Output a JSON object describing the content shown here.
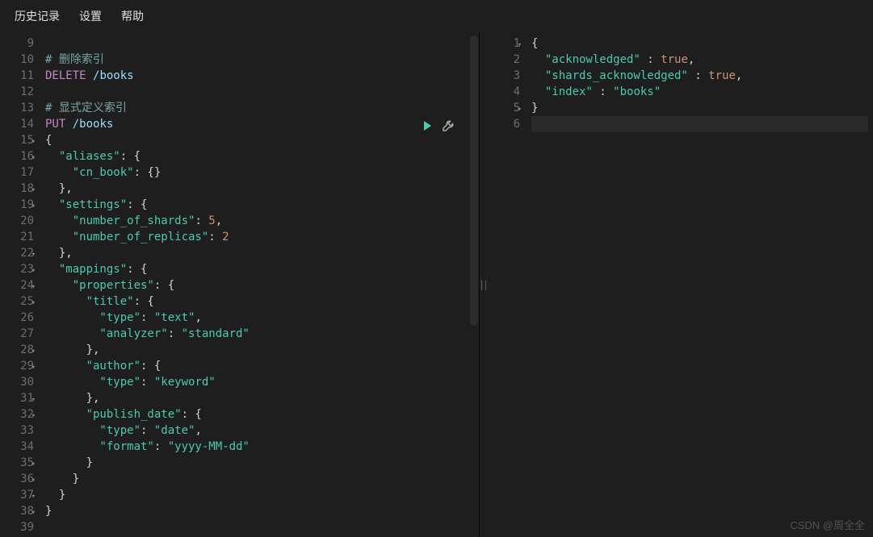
{
  "menu": {
    "history": "历史记录",
    "settings": "设置",
    "help": "帮助"
  },
  "left": {
    "lineStart": 9,
    "foldLines": [
      15,
      16,
      18,
      19,
      22,
      23,
      24,
      25,
      28,
      29,
      31,
      32,
      35,
      36,
      37,
      38
    ],
    "lines": [
      [],
      [
        {
          "t": "# ",
          "c": "comment"
        },
        {
          "t": "删除索引",
          "c": "comment"
        }
      ],
      [
        {
          "t": "DELETE",
          "c": "method"
        },
        {
          "t": " ",
          "c": "punc"
        },
        {
          "t": "/books",
          "c": "path"
        }
      ],
      [],
      [
        {
          "t": "# ",
          "c": "comment"
        },
        {
          "t": "显式定义索引",
          "c": "comment"
        }
      ],
      [
        {
          "t": "PUT",
          "c": "method"
        },
        {
          "t": " ",
          "c": "punc"
        },
        {
          "t": "/books",
          "c": "path"
        }
      ],
      [
        {
          "t": "{",
          "c": "punc"
        }
      ],
      [
        {
          "t": "  \"aliases\"",
          "c": "key"
        },
        {
          "t": ": {",
          "c": "punc"
        }
      ],
      [
        {
          "t": "    \"cn_book\"",
          "c": "key"
        },
        {
          "t": ": {}",
          "c": "punc"
        }
      ],
      [
        {
          "t": "  },",
          "c": "punc"
        }
      ],
      [
        {
          "t": "  \"settings\"",
          "c": "key"
        },
        {
          "t": ": {",
          "c": "punc"
        }
      ],
      [
        {
          "t": "    \"number_of_shards\"",
          "c": "key"
        },
        {
          "t": ": ",
          "c": "punc"
        },
        {
          "t": "5",
          "c": "num"
        },
        {
          "t": ",",
          "c": "punc"
        }
      ],
      [
        {
          "t": "    \"number_of_replicas\"",
          "c": "key"
        },
        {
          "t": ": ",
          "c": "punc"
        },
        {
          "t": "2",
          "c": "num"
        }
      ],
      [
        {
          "t": "  },",
          "c": "punc"
        }
      ],
      [
        {
          "t": "  \"mappings\"",
          "c": "key"
        },
        {
          "t": ": {",
          "c": "punc"
        }
      ],
      [
        {
          "t": "    \"properties\"",
          "c": "key"
        },
        {
          "t": ": {",
          "c": "punc"
        }
      ],
      [
        {
          "t": "      \"title\"",
          "c": "key"
        },
        {
          "t": ": {",
          "c": "punc"
        }
      ],
      [
        {
          "t": "        \"type\"",
          "c": "key"
        },
        {
          "t": ": ",
          "c": "punc"
        },
        {
          "t": "\"text\"",
          "c": "str"
        },
        {
          "t": ",",
          "c": "punc"
        }
      ],
      [
        {
          "t": "        \"analyzer\"",
          "c": "key"
        },
        {
          "t": ": ",
          "c": "punc"
        },
        {
          "t": "\"standard\"",
          "c": "str"
        }
      ],
      [
        {
          "t": "      },",
          "c": "punc"
        }
      ],
      [
        {
          "t": "      \"author\"",
          "c": "key"
        },
        {
          "t": ": {",
          "c": "punc"
        }
      ],
      [
        {
          "t": "        \"type\"",
          "c": "key"
        },
        {
          "t": ": ",
          "c": "punc"
        },
        {
          "t": "\"keyword\"",
          "c": "str"
        }
      ],
      [
        {
          "t": "      },",
          "c": "punc"
        }
      ],
      [
        {
          "t": "      \"publish_date\"",
          "c": "key"
        },
        {
          "t": ": {",
          "c": "punc"
        }
      ],
      [
        {
          "t": "        \"type\"",
          "c": "key"
        },
        {
          "t": ": ",
          "c": "punc"
        },
        {
          "t": "\"date\"",
          "c": "str"
        },
        {
          "t": ",",
          "c": "punc"
        }
      ],
      [
        {
          "t": "        \"format\"",
          "c": "key"
        },
        {
          "t": ": ",
          "c": "punc"
        },
        {
          "t": "\"yyyy-MM-dd\"",
          "c": "str"
        }
      ],
      [
        {
          "t": "      }",
          "c": "punc"
        }
      ],
      [
        {
          "t": "    }",
          "c": "punc"
        }
      ],
      [
        {
          "t": "  }",
          "c": "punc"
        }
      ],
      [
        {
          "t": "}",
          "c": "punc"
        }
      ],
      []
    ]
  },
  "right": {
    "lineStart": 1,
    "highlight": 6,
    "foldLines": [
      1,
      5
    ],
    "lines": [
      [
        {
          "t": "{",
          "c": "punc"
        }
      ],
      [
        {
          "t": "  \"acknowledged\"",
          "c": "key"
        },
        {
          "t": " : ",
          "c": "punc"
        },
        {
          "t": "true",
          "c": "bool"
        },
        {
          "t": ",",
          "c": "punc"
        }
      ],
      [
        {
          "t": "  \"shards_acknowledged\"",
          "c": "key"
        },
        {
          "t": " : ",
          "c": "punc"
        },
        {
          "t": "true",
          "c": "bool"
        },
        {
          "t": ",",
          "c": "punc"
        }
      ],
      [
        {
          "t": "  \"index\"",
          "c": "key"
        },
        {
          "t": " : ",
          "c": "punc"
        },
        {
          "t": "\"books\"",
          "c": "str"
        }
      ],
      [
        {
          "t": "}",
          "c": "punc"
        }
      ],
      []
    ]
  },
  "watermark": "CSDN @周全全"
}
